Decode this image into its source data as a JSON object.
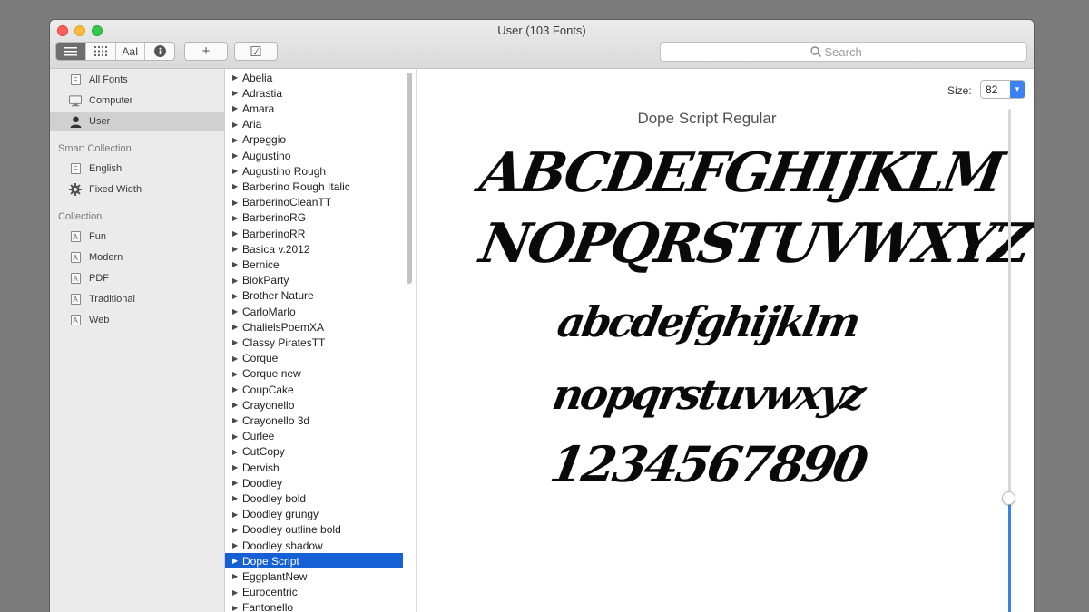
{
  "window": {
    "title": "User (103 Fonts)"
  },
  "toolbar": {
    "view_buttons": [
      "sample-view",
      "grid-view",
      "custom-view",
      "info-view"
    ],
    "custom_view_label": "AaI",
    "add_label": "+",
    "validate_label": "☑",
    "search_placeholder": "Search"
  },
  "sidebar": {
    "library": [
      {
        "label": "All Fonts",
        "icon": "font-file-icon"
      },
      {
        "label": "Computer",
        "icon": "computer-icon"
      },
      {
        "label": "User",
        "icon": "user-icon",
        "selected": true
      }
    ],
    "smart_collection_header": "Smart Collection",
    "smart_collections": [
      {
        "label": "English",
        "icon": "font-file-icon"
      },
      {
        "label": "Fixed Width",
        "icon": "gear-icon"
      }
    ],
    "collection_header": "Collection",
    "collections": [
      {
        "label": "Fun"
      },
      {
        "label": "Modern"
      },
      {
        "label": "PDF"
      },
      {
        "label": "Traditional"
      },
      {
        "label": "Web"
      }
    ]
  },
  "font_list": {
    "items": [
      "Abelia",
      "Adrastia",
      "Amara",
      "Aria",
      "Arpeggio",
      "Augustino",
      "Augustino Rough",
      "Barberino Rough Italic",
      "BarberinoCleanTT",
      "BarberinoRG",
      "BarberinoRR",
      "Basica v.2012",
      "Bernice",
      "BlokParty",
      "Brother Nature",
      "CarloMarlo",
      "ChalielsPoemXA",
      "Classy PiratesTT",
      "Corque",
      "Corque new",
      "CoupCake",
      "Crayonello",
      "Crayonello 3d",
      "Curlee",
      "CutCopy",
      "Dervish",
      "Doodley",
      "Doodley bold",
      "Doodley grungy",
      "Doodley outline bold",
      "Doodley shadow",
      "Dope Script",
      "EggplantNew",
      "Eurocentric",
      "Fantonello"
    ],
    "selected": "Dope Script"
  },
  "preview": {
    "size_label": "Size:",
    "size_value": "82",
    "font_name": "Dope Script Regular",
    "sample_lines": [
      "ABCDEFGHIJKLM",
      "NOPQRSTUVWXYZ",
      "abcdefghijklm",
      "nopqrstuvwxyz",
      "1234567890"
    ],
    "size_slider_fraction": 0.22
  },
  "colors": {
    "selection": "#1560d4",
    "accent": "#3b82f0",
    "sidebar_bg": "#ebebeb"
  }
}
